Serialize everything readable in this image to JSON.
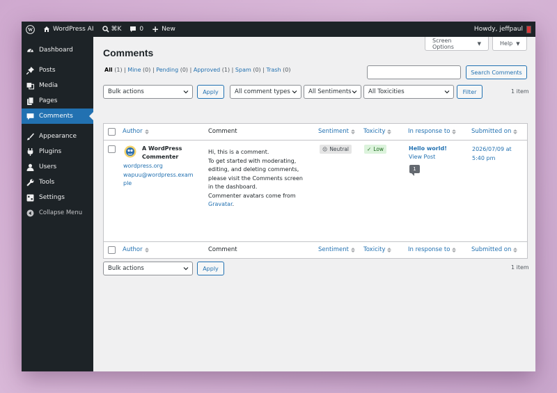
{
  "adminbar": {
    "site_name": "WordPress AI",
    "shortcut": "⌘K",
    "comments_count": "0",
    "new_label": "New",
    "howdy": "Howdy, jeffpaul"
  },
  "sidebar": {
    "items": [
      {
        "label": "Dashboard",
        "icon": "dashboard-icon"
      },
      {
        "label": "Posts",
        "icon": "pushpin-icon"
      },
      {
        "label": "Media",
        "icon": "media-icon"
      },
      {
        "label": "Pages",
        "icon": "pages-icon"
      },
      {
        "label": "Comments",
        "icon": "comment-icon"
      },
      {
        "label": "Appearance",
        "icon": "paintbrush-icon"
      },
      {
        "label": "Plugins",
        "icon": "plug-icon"
      },
      {
        "label": "Users",
        "icon": "user-icon"
      },
      {
        "label": "Tools",
        "icon": "wrench-icon"
      },
      {
        "label": "Settings",
        "icon": "settings-icon"
      }
    ],
    "collapse_label": "Collapse Menu"
  },
  "header": {
    "screen_options": "Screen Options",
    "help": "Help",
    "title": "Comments"
  },
  "filters": {
    "all": "All",
    "all_count": "(1)",
    "mine": "Mine",
    "mine_count": "(0)",
    "pending": "Pending",
    "pending_count": "(0)",
    "approved": "Approved",
    "approved_count": "(1)",
    "spam": "Spam",
    "spam_count": "(0)",
    "trash": "Trash",
    "trash_count": "(0)",
    "separator": "|"
  },
  "search": {
    "button": "Search Comments",
    "value": ""
  },
  "toolbar": {
    "bulk_actions": "Bulk actions",
    "apply": "Apply",
    "comment_types": "All comment types",
    "sentiments": "All Sentiments",
    "toxicities": "All Toxicities",
    "filter": "Filter",
    "item_count": "1 item"
  },
  "table": {
    "columns": {
      "author": "Author",
      "comment": "Comment",
      "sentiment": "Sentiment",
      "toxicity": "Toxicity",
      "in_response_to": "In response to",
      "submitted_on": "Submitted on"
    },
    "rows": [
      {
        "author_name": "A WordPress Commenter",
        "author_url": "wordpress.org",
        "author_email": "wapuu@wordpress.example",
        "comment_1": "Hi, this is a comment.",
        "comment_2": "To get started with moderating, editing, and deleting comments, please visit the Comments screen in the dashboard.",
        "comment_3": "Commenter avatars come from",
        "comment_link": "Gravatar",
        "sentiment": "Neutral",
        "sentiment_icon": "😐",
        "toxicity": "Low",
        "toxicity_icon": "✓",
        "post_title": "Hello world!",
        "view_post": "View Post",
        "post_comment_count": "1",
        "submitted": "2026/07/09 at 5:40 pm"
      }
    ]
  }
}
